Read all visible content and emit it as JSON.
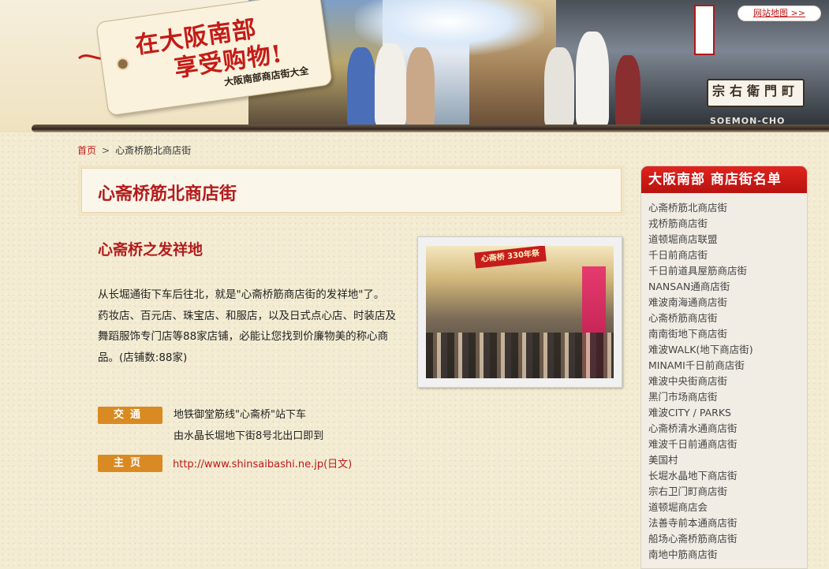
{
  "header": {
    "tag_line1": "在大阪南部",
    "tag_line2": "享受购物!",
    "tag_line3": "大阪南部商店街大全",
    "sitemap_link": "网站地图 >>",
    "sign_text": "宗右衛門町",
    "sign_romaji": "SOEMON-CHO"
  },
  "breadcrumb": {
    "home": "首页",
    "separator": ">",
    "current": "心斎桥筋北商店街"
  },
  "main": {
    "page_title": "心斋桥筋北商店街",
    "subtitle": "心斋桥之发祥地",
    "desc_line1": "从长堀通街下车后往北，就是\"心斋桥筋商店街的发祥地\"了。",
    "desc_line2": "药妆店、百元店、珠宝店、和服店，以及日式点心店、时装店及舞蹈服饰专门店等88家店铺，必能让您找到价廉物美的称心商品。(店铺数:88家)",
    "photo_sign": "心斋桥 330年祭",
    "access_label": "交通",
    "access_line1": "地铁御堂筋线\"心斋桥\"站下车",
    "access_line2": "由水晶长堀地下街8号北出口即到",
    "homepage_label": "主页",
    "homepage_url": "http://www.shinsaibashi.ne.jp(日文)"
  },
  "sidebar": {
    "title": "大阪南部  商店街名单",
    "items": [
      "心斋桥筋北商店街",
      "戎桥筋商店街",
      "道顿堀商店联盟",
      "千日前商店街",
      "千日前道具屋筋商店街",
      "NANSAN通商店街",
      "难波南海通商店街",
      "心斋桥筋商店街",
      "南南街地下商店街",
      "难波WALK(地下商店街)",
      "MINAMI千日前商店街",
      "难波中央街商店街",
      "黑门市场商店街",
      "难波CITY / PARKS",
      "心斋桥清水通商店街",
      "难波千日前通商店街",
      "美国村",
      "长堀水晶地下商店街",
      "宗右卫门町商店街",
      "道顿堀商店会",
      "法善寺前本通商店街",
      "船场心斋桥筋商店街",
      "南地中筋商店街"
    ]
  },
  "colors": {
    "accent_red": "#b31c1c",
    "badge_orange": "#d98a22",
    "sidebar_header": "#d61c18"
  }
}
